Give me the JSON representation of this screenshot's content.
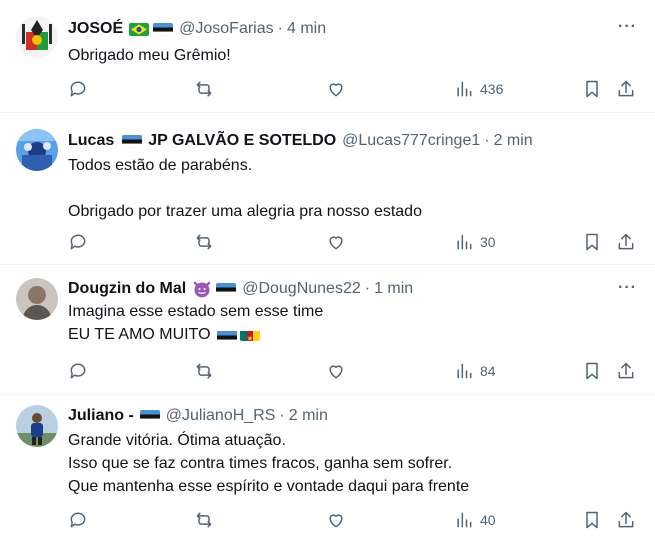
{
  "tweets": [
    {
      "name": "JOSOÉ",
      "handle": "@JosoFarias",
      "sep": "·",
      "time": "4 min",
      "lines": [
        "Obrigado meu  Grêmio!"
      ],
      "views": "436"
    },
    {
      "name": "Lucas",
      "name_suffix": "JP GALVÃO E SOTELDO",
      "handle": "@Lucas777cringe1",
      "sep": "·",
      "time": "2 min",
      "lines": [
        "Todos estão de parabéns.",
        "",
        "Obrigado por trazer uma alegria pra nosso estado"
      ],
      "views": "30"
    },
    {
      "name": "Dougzin do Mal",
      "handle": "@DougNunes22",
      "sep": "·",
      "time": "1 min",
      "lines": [
        "Imagina esse estado sem esse time",
        "EU TE AMO MUITO"
      ],
      "views": "84"
    },
    {
      "name": "Juliano -",
      "handle": "@JulianoH_RS",
      "sep": "·",
      "time": "2 min",
      "lines": [
        "Grande vitória. Ótima atuação.",
        "Isso que se faz contra times fracos, ganha sem sofrer.",
        "Que mantenha esse espírito e vontade daqui para frente"
      ],
      "views": "40"
    }
  ],
  "more_glyph": "···",
  "icons": [
    "reply-icon",
    "retweet-icon",
    "like-icon",
    "views-icon",
    "bookmark-icon",
    "share-icon"
  ],
  "colors": {
    "text": "#0f1419",
    "muted": "#536471",
    "divider": "#eff3f4",
    "grimace_emoji": "#9b59b6"
  }
}
